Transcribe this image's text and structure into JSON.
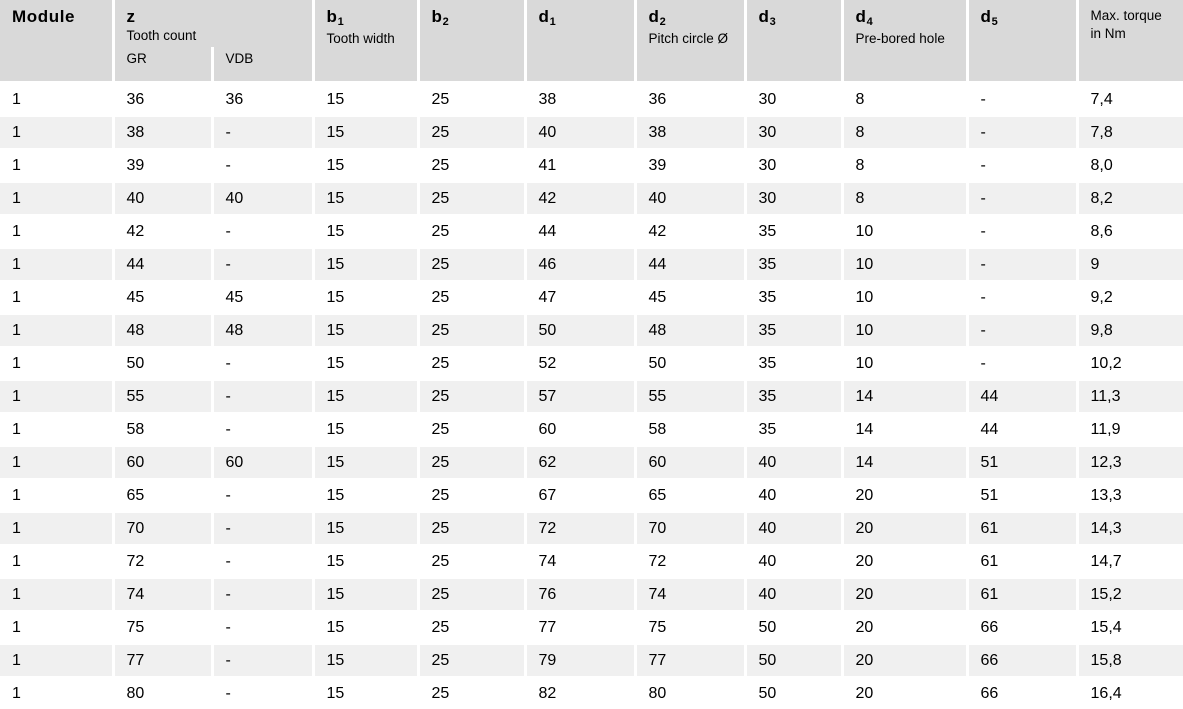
{
  "table": {
    "columns": [
      {
        "symbol": "Module",
        "sub": "",
        "desc": "",
        "name": "module"
      },
      {
        "symbol": "z",
        "sub": "",
        "desc": "Tooth count",
        "name": "tooth-count",
        "subcolumns": [
          "GR",
          "VDB"
        ]
      },
      {
        "symbol": "b",
        "sub": "1",
        "desc": "Tooth width",
        "name": "tooth-width"
      },
      {
        "symbol": "b",
        "sub": "2",
        "desc": "",
        "name": "b2"
      },
      {
        "symbol": "d",
        "sub": "1",
        "desc": "",
        "name": "d1"
      },
      {
        "symbol": "d",
        "sub": "2",
        "desc": "Pitch circle Ø",
        "name": "pitch-circle-diameter"
      },
      {
        "symbol": "d",
        "sub": "3",
        "desc": "",
        "name": "d3"
      },
      {
        "symbol": "d",
        "sub": "4",
        "desc": "Pre-bored hole",
        "name": "pre-bored-hole"
      },
      {
        "symbol": "d",
        "sub": "5",
        "desc": "",
        "name": "d5"
      },
      {
        "symbol": "Max. torque",
        "sub": "",
        "desc": "in Nm",
        "name": "max-torque"
      }
    ],
    "column_keys": [
      "module",
      "z_gr",
      "z_vdb",
      "b1",
      "b2",
      "d1",
      "d2",
      "d3",
      "d4",
      "d5",
      "torque"
    ],
    "rows": [
      {
        "module": "1",
        "z_gr": "36",
        "z_vdb": "36",
        "b1": "15",
        "b2": "25",
        "d1": "38",
        "d2": "36",
        "d3": "30",
        "d4": "8",
        "d5": "-",
        "torque": "7,4"
      },
      {
        "module": "1",
        "z_gr": "38",
        "z_vdb": "-",
        "b1": "15",
        "b2": "25",
        "d1": "40",
        "d2": "38",
        "d3": "30",
        "d4": "8",
        "d5": "-",
        "torque": "7,8"
      },
      {
        "module": "1",
        "z_gr": "39",
        "z_vdb": "-",
        "b1": "15",
        "b2": "25",
        "d1": "41",
        "d2": "39",
        "d3": "30",
        "d4": "8",
        "d5": "-",
        "torque": "8,0"
      },
      {
        "module": "1",
        "z_gr": "40",
        "z_vdb": "40",
        "b1": "15",
        "b2": "25",
        "d1": "42",
        "d2": "40",
        "d3": "30",
        "d4": "8",
        "d5": "-",
        "torque": "8,2"
      },
      {
        "module": "1",
        "z_gr": "42",
        "z_vdb": "-",
        "b1": "15",
        "b2": "25",
        "d1": "44",
        "d2": "42",
        "d3": "35",
        "d4": "10",
        "d5": "-",
        "torque": "8,6"
      },
      {
        "module": "1",
        "z_gr": "44",
        "z_vdb": "-",
        "b1": "15",
        "b2": "25",
        "d1": "46",
        "d2": "44",
        "d3": "35",
        "d4": "10",
        "d5": "-",
        "torque": "9"
      },
      {
        "module": "1",
        "z_gr": "45",
        "z_vdb": "45",
        "b1": "15",
        "b2": "25",
        "d1": "47",
        "d2": "45",
        "d3": "35",
        "d4": "10",
        "d5": "-",
        "torque": "9,2"
      },
      {
        "module": "1",
        "z_gr": "48",
        "z_vdb": "48",
        "b1": "15",
        "b2": "25",
        "d1": "50",
        "d2": "48",
        "d3": "35",
        "d4": "10",
        "d5": "-",
        "torque": "9,8"
      },
      {
        "module": "1",
        "z_gr": "50",
        "z_vdb": "-",
        "b1": "15",
        "b2": "25",
        "d1": "52",
        "d2": "50",
        "d3": "35",
        "d4": "10",
        "d5": "-",
        "torque": "10,2"
      },
      {
        "module": "1",
        "z_gr": "55",
        "z_vdb": "-",
        "b1": "15",
        "b2": "25",
        "d1": "57",
        "d2": "55",
        "d3": "35",
        "d4": "14",
        "d5": "44",
        "torque": "11,3"
      },
      {
        "module": "1",
        "z_gr": "58",
        "z_vdb": "-",
        "b1": "15",
        "b2": "25",
        "d1": "60",
        "d2": "58",
        "d3": "35",
        "d4": "14",
        "d5": "44",
        "torque": "11,9"
      },
      {
        "module": "1",
        "z_gr": "60",
        "z_vdb": "60",
        "b1": "15",
        "b2": "25",
        "d1": "62",
        "d2": "60",
        "d3": "40",
        "d4": "14",
        "d5": "51",
        "torque": "12,3"
      },
      {
        "module": "1",
        "z_gr": "65",
        "z_vdb": "-",
        "b1": "15",
        "b2": "25",
        "d1": "67",
        "d2": "65",
        "d3": "40",
        "d4": "20",
        "d5": "51",
        "torque": "13,3"
      },
      {
        "module": "1",
        "z_gr": "70",
        "z_vdb": "-",
        "b1": "15",
        "b2": "25",
        "d1": "72",
        "d2": "70",
        "d3": "40",
        "d4": "20",
        "d5": "61",
        "torque": "14,3"
      },
      {
        "module": "1",
        "z_gr": "72",
        "z_vdb": "-",
        "b1": "15",
        "b2": "25",
        "d1": "74",
        "d2": "72",
        "d3": "40",
        "d4": "20",
        "d5": "61",
        "torque": "14,7"
      },
      {
        "module": "1",
        "z_gr": "74",
        "z_vdb": "-",
        "b1": "15",
        "b2": "25",
        "d1": "76",
        "d2": "74",
        "d3": "40",
        "d4": "20",
        "d5": "61",
        "torque": "15,2"
      },
      {
        "module": "1",
        "z_gr": "75",
        "z_vdb": "-",
        "b1": "15",
        "b2": "25",
        "d1": "77",
        "d2": "75",
        "d3": "50",
        "d4": "20",
        "d5": "66",
        "torque": "15,4"
      },
      {
        "module": "1",
        "z_gr": "77",
        "z_vdb": "-",
        "b1": "15",
        "b2": "25",
        "d1": "79",
        "d2": "77",
        "d3": "50",
        "d4": "20",
        "d5": "66",
        "torque": "15,8"
      },
      {
        "module": "1",
        "z_gr": "80",
        "z_vdb": "-",
        "b1": "15",
        "b2": "25",
        "d1": "82",
        "d2": "80",
        "d3": "50",
        "d4": "20",
        "d5": "66",
        "torque": "16,4"
      }
    ]
  },
  "colors": {
    "header_background": "#d9d9d9",
    "row_background": "#ffffff",
    "row_alt_background": "#f0f0f0",
    "gridline": "#ffffff",
    "text": "#000000"
  }
}
